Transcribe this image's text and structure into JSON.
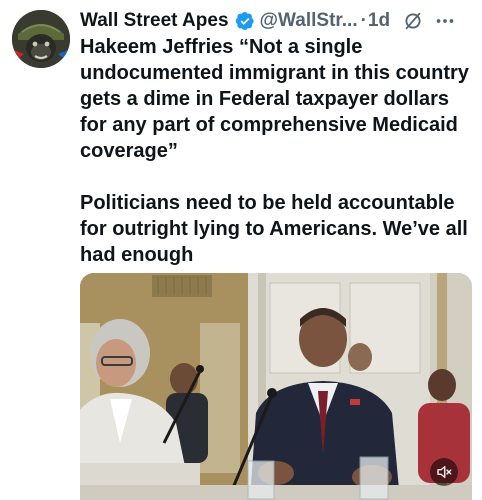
{
  "tweet": {
    "author_name": "Wall Street Apes",
    "handle": "@WallStr...",
    "separator": "·",
    "time": "1d",
    "paragraphs": [
      "Hakeem Jeffries “Not a single undocumented immigrant in this country gets a dime in Federal taxpayer dollars for any part of comprehensive Medicaid coverage”",
      "Politicians need to be held accountable for outright lying to Americans. We’ve all had enough"
    ]
  },
  "icons": {
    "verified": "verified-badge-icon",
    "grok": "grok-icon",
    "more": "more-options-icon",
    "mute": "muted-speaker-icon"
  },
  "colors": {
    "verified_badge": "#1d9bf0",
    "secondary_text": "#536471",
    "primary_text": "#0f1419"
  }
}
